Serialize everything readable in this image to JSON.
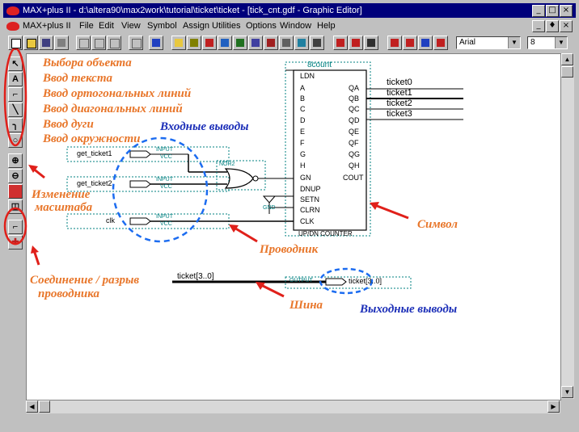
{
  "window": {
    "title": "MAX+plus II - d:\\altera90\\max2work\\tutorial\\ticket\\ticket - [tick_cnt.gdf - Graphic Editor]",
    "minimize": "_",
    "maximize": "□",
    "close": "×",
    "doc_min": "_",
    "doc_max": "♦",
    "doc_close": "×"
  },
  "menu": {
    "items": [
      {
        "label": "MAX+plus II"
      },
      {
        "label": "File"
      },
      {
        "label": "Edit"
      },
      {
        "label": "View"
      },
      {
        "label": "Symbol"
      },
      {
        "label": "Assign"
      },
      {
        "label": "Utilities"
      },
      {
        "label": "Options"
      },
      {
        "label": "Window"
      },
      {
        "label": "Help"
      }
    ]
  },
  "toolbar": {
    "font": "Arial",
    "size": "8"
  },
  "symbol": {
    "name": "8count",
    "subtitle": "UP/DN COUNTER",
    "inputs": [
      "LDN",
      "A",
      "B",
      "C",
      "D",
      "E",
      "F",
      "G",
      "H",
      "GN",
      "DNUP",
      "SETN",
      "CLRN",
      "CLK"
    ],
    "outputs": [
      "QA",
      "QB",
      "QC",
      "QD",
      "QE",
      "QF",
      "QG",
      "QH",
      "COUT"
    ]
  },
  "schematic": {
    "input_pins": [
      "get_ticket1",
      "get_ticket2",
      "clk"
    ],
    "pin_type_input": "INPUT",
    "pin_vcc": "VCC",
    "pin_type_output": "OUTPUT",
    "gate_label": "NOR2",
    "gnd_label": "GND",
    "output_nets": [
      "ticket0",
      "ticket1",
      "ticket2",
      "ticket3"
    ],
    "bus_name": "ticket[3..0]",
    "output_pin": "ticket[3..0]"
  },
  "annotations": {
    "select": "Выбора объекта",
    "text": "Ввод текста",
    "ortho": "Ввод ортогональных линий",
    "diag": "Ввод диагональных линий",
    "arc": "Ввод дуги",
    "circle": "Ввод окружности",
    "inputs": "Входные выводы",
    "zoom": "Изменение\nмасштаба",
    "zoom1": "Изменение",
    "zoom2": "масштаба",
    "symbol": "Символ",
    "wire": "Проводник",
    "connect1": "Соединение / разрыв",
    "connect2": "проводника",
    "bus": "Шина",
    "outputs": "Выходные выводы"
  },
  "colors": {
    "title_bg": "#00007b",
    "annotation_orange": "#e8762a",
    "annotation_blue": "#1c2fb8",
    "highlight_red": "#e0201a"
  }
}
